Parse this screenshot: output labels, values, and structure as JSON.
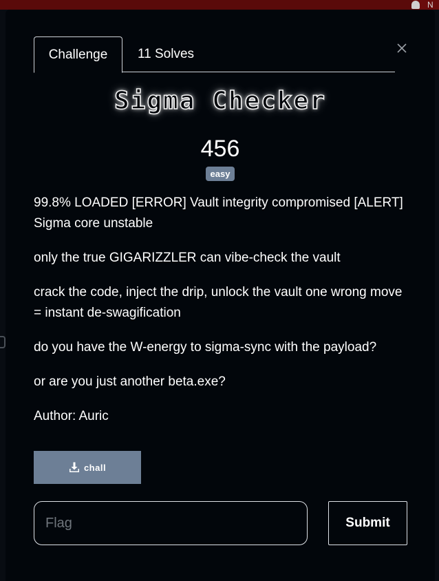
{
  "header": {
    "right_glyph": "N"
  },
  "tabs": [
    {
      "label": "Challenge",
      "active": true
    },
    {
      "label": "11 Solves",
      "active": false
    }
  ],
  "close_icon": "close-icon",
  "challenge": {
    "name": "Sigma Checker",
    "points": "456",
    "difficulty": "easy",
    "description": [
      "99.8% LOADED [ERROR] Vault integrity compromised [ALERT] Sigma core unstable",
      "only the true GIGARIZZLER can vibe-check the vault",
      "crack the code, inject the drip, unlock the vault one wrong move = instant de-swagification",
      "do you have the W-energy to sigma-sync with the payload?",
      "or are you just another beta.exe?",
      "Author: Auric"
    ]
  },
  "download": {
    "label": "chall",
    "icon": "download-icon"
  },
  "flag_input": {
    "placeholder": "Flag",
    "value": ""
  },
  "submit": {
    "label": "Submit"
  },
  "colors": {
    "background": "#02060b",
    "badge": "#6d7f96",
    "button": "#6d7f96",
    "topbar": "#5a0a0a"
  }
}
